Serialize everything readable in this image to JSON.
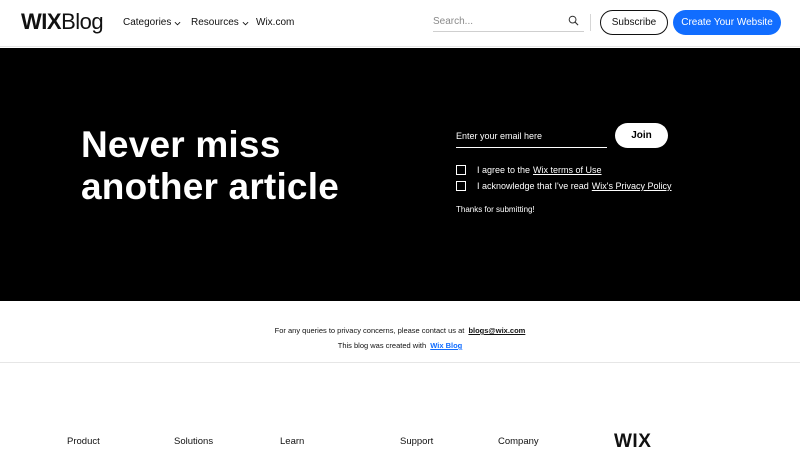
{
  "header": {
    "logo_wix": "WIX",
    "logo_blog": "Blog",
    "nav": {
      "categories": "Categories",
      "resources": "Resources",
      "wixcom": "Wix.com"
    },
    "search": {
      "placeholder": "Search..."
    },
    "subscribe_label": "Subscribe",
    "create_label": "Create Your Website"
  },
  "hero": {
    "title": "Never miss another article",
    "email_placeholder": "Enter your email here",
    "join_label": "Join",
    "terms_text": "I agree to the",
    "terms_link": "Wix terms of Use",
    "privacy_text": "I acknowledge that I've read",
    "privacy_link": "Wix's Privacy Policy",
    "thanks": "Thanks for submitting!"
  },
  "info": {
    "privacy_text": "For any queries to privacy concerns, please contact us at",
    "privacy_email": "blogs@wix.com",
    "created_text": "This blog was created with",
    "created_link": "Wix Blog"
  },
  "footer": {
    "columns": [
      "Product",
      "Solutions",
      "Learn",
      "Support",
      "Company"
    ],
    "logo": "WIX"
  },
  "colors": {
    "accent": "#116dff",
    "hero_bg": "#000000"
  },
  "icons": {
    "search": "search-icon",
    "chevron": "chevron-down-icon"
  }
}
